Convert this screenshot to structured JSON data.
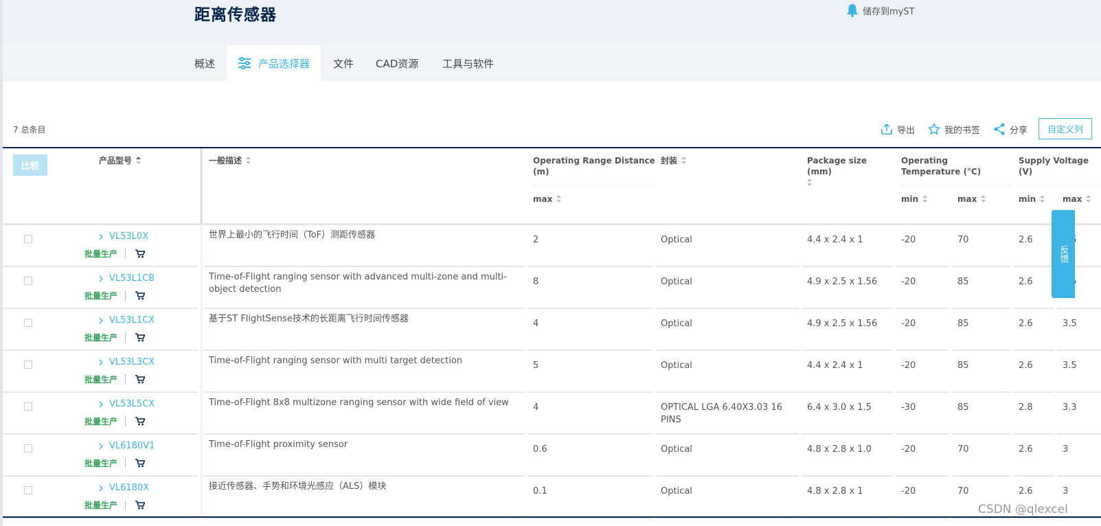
{
  "header": {
    "title": "距离传感器",
    "save_to_myst": "储存到myST"
  },
  "tabs": [
    {
      "label": "概述",
      "active": false
    },
    {
      "label": "产品选择器",
      "active": true
    },
    {
      "label": "文件",
      "active": false
    },
    {
      "label": "CAD资源",
      "active": false
    },
    {
      "label": "工具与软件",
      "active": false
    }
  ],
  "toolbar": {
    "total_count": "7 总条目",
    "export": "导出",
    "bookmark": "我的书签",
    "share": "分享",
    "custom_columns": "自定义列"
  },
  "table": {
    "compare_label": "比较",
    "headers": {
      "part_number": "产品型号",
      "description": "一般描述",
      "range": "Operating Range Distance (m)",
      "range_sub": "max",
      "package": "封装",
      "package_size": "Package size (mm)",
      "temp": "Operating Temperature (°C)",
      "temp_min": "min",
      "temp_max": "max",
      "voltage": "Supply Voltage (V)",
      "volt_min": "min",
      "volt_max": "max"
    },
    "rows": [
      {
        "part": "VL53L0X",
        "status": "批量生产",
        "desc": "世界上最小的飞行时间（ToF）测距传感器",
        "range_max": "2",
        "package": "Optical",
        "size": "4.4 x 2.4 x 1",
        "temp_min": "-20",
        "temp_max": "70",
        "volt_min": "2.6",
        "volt_max": "3.5"
      },
      {
        "part": "VL53L1CB",
        "status": "批量生产",
        "desc": "Time-of-Flight ranging sensor with advanced multi-zone and multi-object detection",
        "range_max": "8",
        "package": "Optical",
        "size": "4.9 x 2.5 x 1.56",
        "temp_min": "-20",
        "temp_max": "85",
        "volt_min": "2.6",
        "volt_max": "3.5"
      },
      {
        "part": "VL53L1CX",
        "status": "批量生产",
        "desc": "基于ST FlightSense技术的长距离飞行时间传感器",
        "range_max": "4",
        "package": "Optical",
        "size": "4.9 x 2.5 x 1.56",
        "temp_min": "-20",
        "temp_max": "85",
        "volt_min": "2.6",
        "volt_max": "3.5"
      },
      {
        "part": "VL53L3CX",
        "status": "批量生产",
        "desc": "Time-of-Flight ranging sensor with multi target detection",
        "range_max": "5",
        "package": "Optical",
        "size": "4.4 x 2.4 x 1",
        "temp_min": "-20",
        "temp_max": "85",
        "volt_min": "2.6",
        "volt_max": "3.5"
      },
      {
        "part": "VL53L5CX",
        "status": "批量生产",
        "desc": "Time-of-Flight 8x8 multizone ranging sensor with wide field of view",
        "range_max": "4",
        "package": "OPTICAL LGA 6.40X3.03 16 PINS",
        "size": "6.4 x 3.0 x 1.5",
        "temp_min": "-30",
        "temp_max": "85",
        "volt_min": "2.8",
        "volt_max": "3.3"
      },
      {
        "part": "VL6180V1",
        "status": "批量生产",
        "desc": "Time-of-Flight proximity sensor",
        "range_max": "0.6",
        "package": "Optical",
        "size": "4.8 x 2.8 x 1.0",
        "temp_min": "-20",
        "temp_max": "70",
        "volt_min": "2.6",
        "volt_max": "3"
      },
      {
        "part": "VL6180X",
        "status": "批量生产",
        "desc": "接近传感器、手势和环境光感应（ALS）模块",
        "range_max": "0.1",
        "package": "Optical",
        "size": "4.8 x 2.8 x 1",
        "temp_min": "-20",
        "temp_max": "70",
        "volt_min": "2.6",
        "volt_max": "3"
      }
    ]
  },
  "feedback": "反馈",
  "watermark": "CSDN @qlexcel",
  "colors": {
    "accent": "#3cb4e6",
    "title": "#03234b",
    "status_green": "#3ba35e"
  }
}
